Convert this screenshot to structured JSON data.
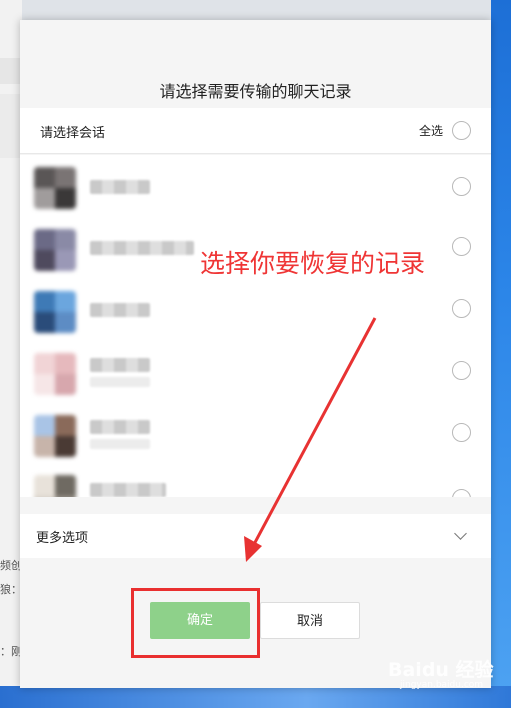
{
  "background": {
    "left_fragments": [
      "频创",
      "狼：",
      "：刚"
    ]
  },
  "dialog": {
    "title": "请选择需要传输的聊天记录",
    "list_header": {
      "label": "请选择会话",
      "select_all_label": "全选"
    },
    "conversations": [
      {
        "selected": false,
        "avatar_colors": [
          "#5a5656",
          "#7a7474",
          "#a09c9c",
          "#3a3838"
        ]
      },
      {
        "selected": false,
        "avatar_colors": [
          "#6b6a86",
          "#8a8aa6",
          "#4f4a5e",
          "#9a98b6"
        ]
      },
      {
        "selected": false,
        "avatar_colors": [
          "#3e7ab6",
          "#6ba6de",
          "#2a4c7a",
          "#5d8cc4"
        ]
      },
      {
        "selected": false,
        "avatar_colors": [
          "#f1d4d6",
          "#e6b9bd",
          "#f6e6e7",
          "#d7a7ad"
        ]
      },
      {
        "selected": false,
        "avatar_colors": [
          "#a9c4e6",
          "#8a6a5a",
          "#c7b4aa",
          "#4a3a34"
        ]
      },
      {
        "selected": false,
        "avatar_colors": [
          "#e8e2da",
          "#6f6a62",
          "#d8d2ca",
          "#9a948c"
        ]
      }
    ],
    "more_options_label": "更多选项",
    "confirm_label": "确定",
    "cancel_label": "取消",
    "confirm_color": "#8ed18a"
  },
  "annotation": {
    "text": "选择你要恢复的记录",
    "color": "#ef3535"
  },
  "watermark": {
    "brand": "Baidu 经验",
    "url": "jingyan.baidu.com"
  }
}
